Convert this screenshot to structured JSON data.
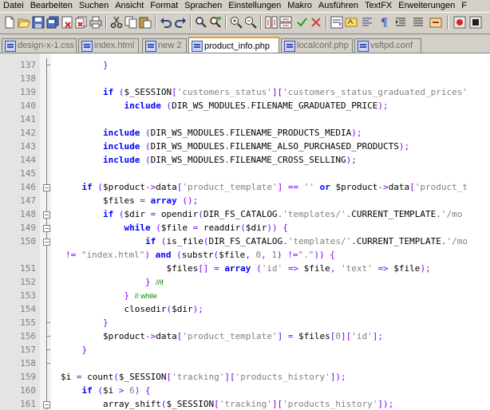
{
  "menu": [
    "Datei",
    "Bearbeiten",
    "Suchen",
    "Ansicht",
    "Format",
    "Sprachen",
    "Einstellungen",
    "Makro",
    "Ausführen",
    "TextFX",
    "Erweiterungen",
    "F"
  ],
  "tabs": [
    {
      "label": "design-x-1.css",
      "active": false
    },
    {
      "label": "index.html",
      "active": false
    },
    {
      "label": "new  2",
      "active": false
    },
    {
      "label": "product_info.php",
      "active": true
    },
    {
      "label": "localconf.php",
      "active": false
    },
    {
      "label": "vsftpd.conf",
      "active": false
    }
  ],
  "lines": [
    {
      "n": "137",
      "html": "        <span class='op'>}</span>"
    },
    {
      "n": "138",
      "html": ""
    },
    {
      "n": "139",
      "html": "        <span class='kw'>if</span> <span class='op'>(</span>$_SESSION<span class='op'>[</span><span class='str'>'customers_status'</span><span class='op'>][</span><span class='str'>'customers_status_graduated_prices'</span>"
    },
    {
      "n": "140",
      "html": "            <span class='kw'>include</span> <span class='op'>(</span>DIR_WS_MODULES<span class='op'>.</span>FILENAME_GRADUATED_PRICE<span class='op'>);</span>"
    },
    {
      "n": "141",
      "html": ""
    },
    {
      "n": "142",
      "html": "        <span class='kw'>include</span> <span class='op'>(</span>DIR_WS_MODULES<span class='op'>.</span>FILENAME_PRODUCTS_MEDIA<span class='op'>);</span>"
    },
    {
      "n": "143",
      "html": "        <span class='kw'>include</span> <span class='op'>(</span>DIR_WS_MODULES<span class='op'>.</span>FILENAME_ALSO_PURCHASED_PRODUCTS<span class='op'>);</span>"
    },
    {
      "n": "144",
      "html": "        <span class='kw'>include</span> <span class='op'>(</span>DIR_WS_MODULES<span class='op'>.</span>FILENAME_CROSS_SELLING<span class='op'>);</span>"
    },
    {
      "n": "145",
      "html": ""
    },
    {
      "n": "146",
      "html": "    <span class='kw'>if</span> <span class='op'>(</span>$product<span class='op'>-&gt;</span>data<span class='op'>[</span><span class='str'>'product_template'</span><span class='op'>]</span> <span class='op'>==</span> <span class='str'>''</span> <span class='kw'>or</span> $product<span class='op'>-&gt;</span>data<span class='op'>[</span><span class='str'>'product_t</span>"
    },
    {
      "n": "147",
      "html": "        $files <span class='op'>=</span> <span class='kw'>array</span> <span class='op'>();</span>"
    },
    {
      "n": "148",
      "html": "        <span class='kw'>if</span> <span class='op'>(</span>$dir <span class='op'>=</span> opendir<span class='op'>(</span>DIR_FS_CATALOG<span class='op'>.</span><span class='str'>'templates/'</span><span class='op'>.</span>CURRENT_TEMPLATE<span class='op'>.</span><span class='str'>'/mo</span>"
    },
    {
      "n": "149",
      "html": "            <span class='kw'>while</span> <span class='op'>(</span>$file <span class='op'>=</span> readdir<span class='op'>(</span>$dir<span class='op'>))</span> <span class='op'>{</span>"
    },
    {
      "n": "150",
      "html": "                <span class='kw'>if</span> <span class='op'>(</span>is_file<span class='op'>(</span>DIR_FS_CATALOG<span class='op'>.</span><span class='str'>'templates/'</span><span class='op'>.</span>CURRENT_TEMPLATE<span class='op'>.</span><span class='str'>'/mo</span>"
    },
    {
      "n": "",
      "html": "<span class='op'>!=</span> <span class='str'>\"index.html\"</span><span class='op'>)</span> <span class='kw'>and</span> <span class='op'>(</span>substr<span class='op'>(</span>$file<span class='op'>,</span> <span class='str'>0</span><span class='op'>,</span> <span class='str'>1</span><span class='op'>)</span> <span class='op'>!=</span><span class='str'>\".\"</span><span class='op'>))</span> <span class='op'>{</span>",
      "wrap": true
    },
    {
      "n": "151",
      "html": "                    $files<span class='op'>[]</span> <span class='op'>=</span> <span class='kw'>array</span> <span class='op'>(</span><span class='str'>'id'</span> <span class='op'>=&gt;</span> $file<span class='op'>,</span> <span class='str'>'text'</span> <span class='op'>=&gt;</span> $file<span class='op'>);</span>"
    },
    {
      "n": "152",
      "html": "                <span class='op'>}</span> <span class='cm'>//if</span>"
    },
    {
      "n": "153",
      "html": "            <span class='op'>}</span> <span class='cm'>// while</span>"
    },
    {
      "n": "154",
      "html": "            closedir<span class='op'>(</span>$dir<span class='op'>);</span>"
    },
    {
      "n": "155",
      "html": "        <span class='op'>}</span>"
    },
    {
      "n": "156",
      "html": "        $product<span class='op'>-&gt;</span>data<span class='op'>[</span><span class='str'>'product_template'</span><span class='op'>]</span> <span class='op'>=</span> $files<span class='op'>[</span><span class='str'>0</span><span class='op'>][</span><span class='str'>'id'</span><span class='op'>];</span>"
    },
    {
      "n": "157",
      "html": "    <span class='op'>}</span>"
    },
    {
      "n": "158",
      "html": ""
    },
    {
      "n": "159",
      "html": "$i <span class='op'>=</span> count<span class='op'>(</span>$_SESSION<span class='op'>[</span><span class='str'>'tracking'</span><span class='op'>][</span><span class='str'>'products_history'</span><span class='op'>]);</span>"
    },
    {
      "n": "160",
      "html": "    <span class='kw'>if</span> <span class='op'>(</span>$i <span class='op'>&gt;</span> <span class='str'>6</span><span class='op'>)</span> <span class='op'>{</span>"
    },
    {
      "n": "161",
      "html": "        array_shift<span class='op'>(</span>$_SESSION<span class='op'>[</span><span class='str'>'tracking'</span><span class='op'>][</span><span class='str'>'products_history'</span><span class='op'>]);</span>"
    }
  ]
}
